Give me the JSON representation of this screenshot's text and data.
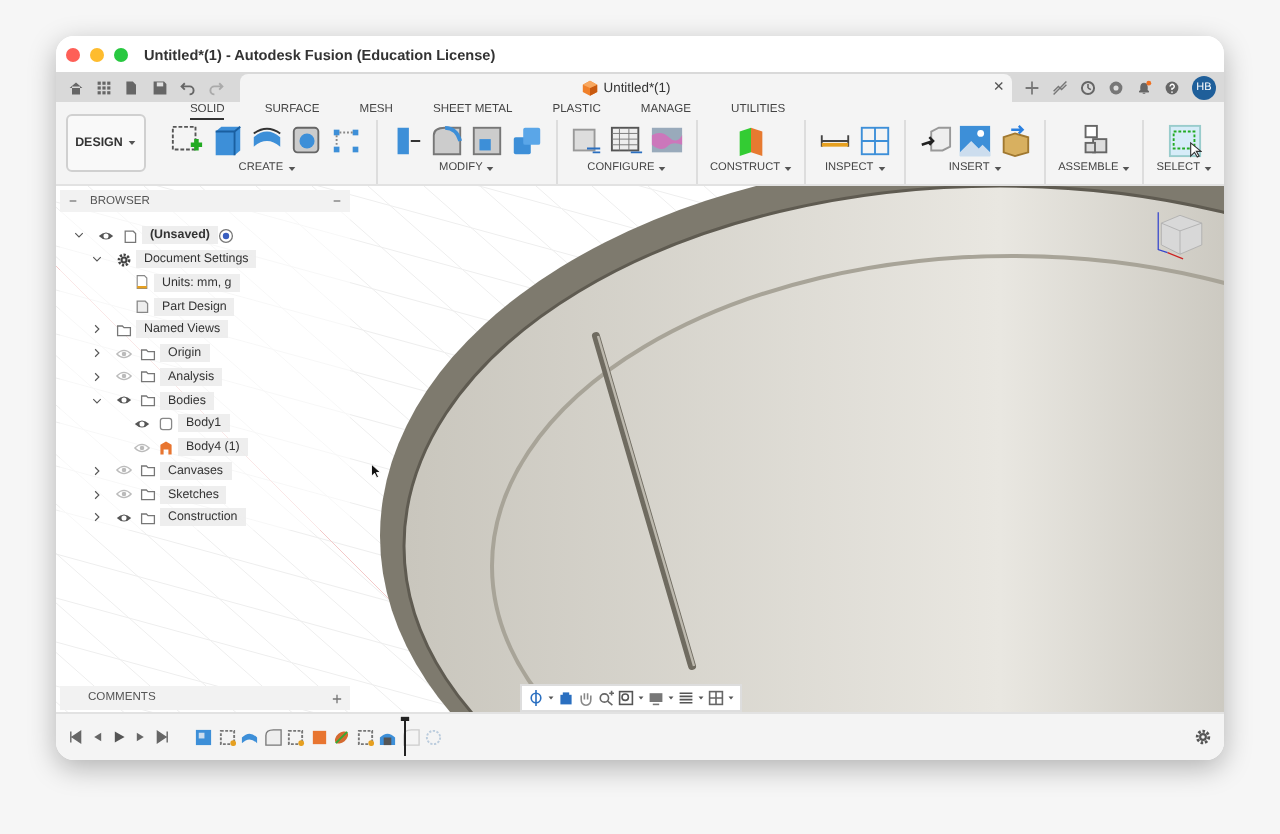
{
  "window": {
    "title": "Untitled*(1) - Autodesk Fusion (Education License)"
  },
  "document_tab": {
    "title": "Untitled*(1)",
    "close": "×"
  },
  "user": {
    "initials": "HB"
  },
  "workspace": {
    "label": "DESIGN"
  },
  "tabs": [
    {
      "label": "SOLID",
      "selected": true
    },
    {
      "label": "SURFACE",
      "selected": false
    },
    {
      "label": "MESH",
      "selected": false
    },
    {
      "label": "SHEET METAL",
      "selected": false
    },
    {
      "label": "PLASTIC",
      "selected": false
    },
    {
      "label": "MANAGE",
      "selected": false
    },
    {
      "label": "UTILITIES",
      "selected": false
    }
  ],
  "tool_groups": [
    {
      "label": "CREATE"
    },
    {
      "label": "MODIFY"
    },
    {
      "label": "CONFIGURE"
    },
    {
      "label": "CONSTRUCT"
    },
    {
      "label": "INSPECT"
    },
    {
      "label": "INSERT"
    },
    {
      "label": "ASSEMBLE"
    },
    {
      "label": "SELECT"
    }
  ],
  "browser": {
    "title": "BROWSER",
    "tree": [
      {
        "label": "(Unsaved)",
        "kind": "component",
        "expanded": true,
        "visible": true,
        "children": [
          {
            "label": "Document Settings",
            "kind": "settings",
            "expanded": true,
            "children": [
              {
                "label": "Units: mm, g",
                "kind": "units"
              },
              {
                "label": "Part Design",
                "kind": "design"
              }
            ]
          },
          {
            "label": "Named Views",
            "kind": "views",
            "expanded": false
          },
          {
            "label": "Origin",
            "kind": "folder",
            "expanded": false,
            "visible": false
          },
          {
            "label": "Analysis",
            "kind": "folder",
            "expanded": false,
            "visible": false
          },
          {
            "label": "Bodies",
            "kind": "folder",
            "expanded": true,
            "visible": true,
            "children": [
              {
                "label": "Body1",
                "kind": "body",
                "visible": true
              },
              {
                "label": "Body4 (1)",
                "kind": "body-colored",
                "visible": false
              }
            ]
          },
          {
            "label": "Canvases",
            "kind": "folder",
            "expanded": false,
            "visible": false
          },
          {
            "label": "Sketches",
            "kind": "folder",
            "expanded": false,
            "visible": false
          },
          {
            "label": "Construction",
            "kind": "folder",
            "expanded": false,
            "visible": true
          }
        ]
      }
    ]
  },
  "comments": {
    "title": "COMMENTS"
  }
}
